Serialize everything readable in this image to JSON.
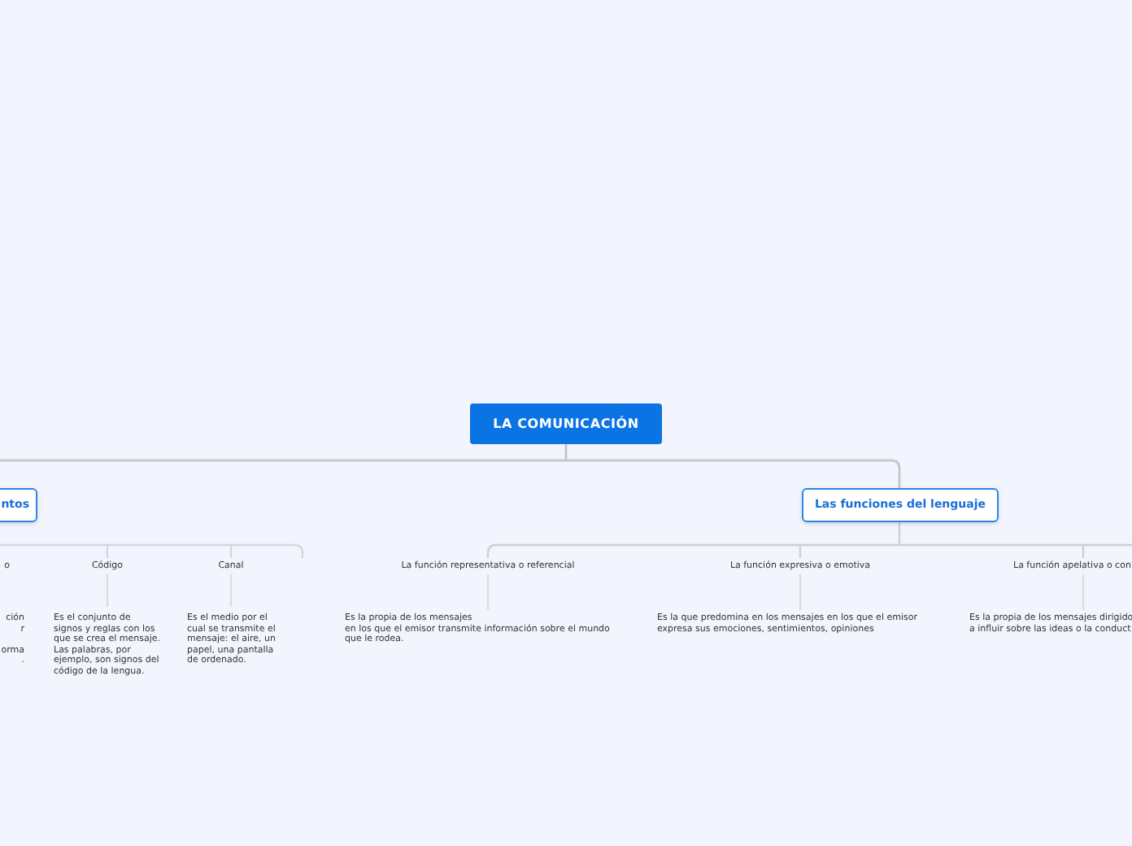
{
  "root": {
    "title": "LA COMUNICACIÓN"
  },
  "branches": [
    {
      "title": "ntos",
      "children": [
        {
          "title": "o",
          "description": "ción\nr\n\norma\n."
        },
        {
          "title": "Código",
          "description": "Es el conjunto de signos y reglas con los que se crea el mensaje. Las palabras, por ejemplo, son signos del código de la lengua."
        },
        {
          "title": "Canal",
          "description": "Es el medio por el cual se transmite el mensaje: el aire, un papel, una pantalla de ordenado."
        }
      ]
    },
    {
      "title": "Las funciones del lenguaje",
      "children": [
        {
          "title": "La función representativa o referencial",
          "description": "Es la propia de los mensajes\nen los que el emisor transmite información sobre el mundo que le rodea."
        },
        {
          "title": "La función expresiva o emotiva",
          "description": "Es la que predomina en los mensajes en los que el emisor expresa sus emociones, sentimientos, opiniones"
        },
        {
          "title": "La función apelativa o con",
          "description": "Es la propia de los mensajes dirigido\na influir sobre las ideas o la conduct"
        }
      ]
    }
  ]
}
